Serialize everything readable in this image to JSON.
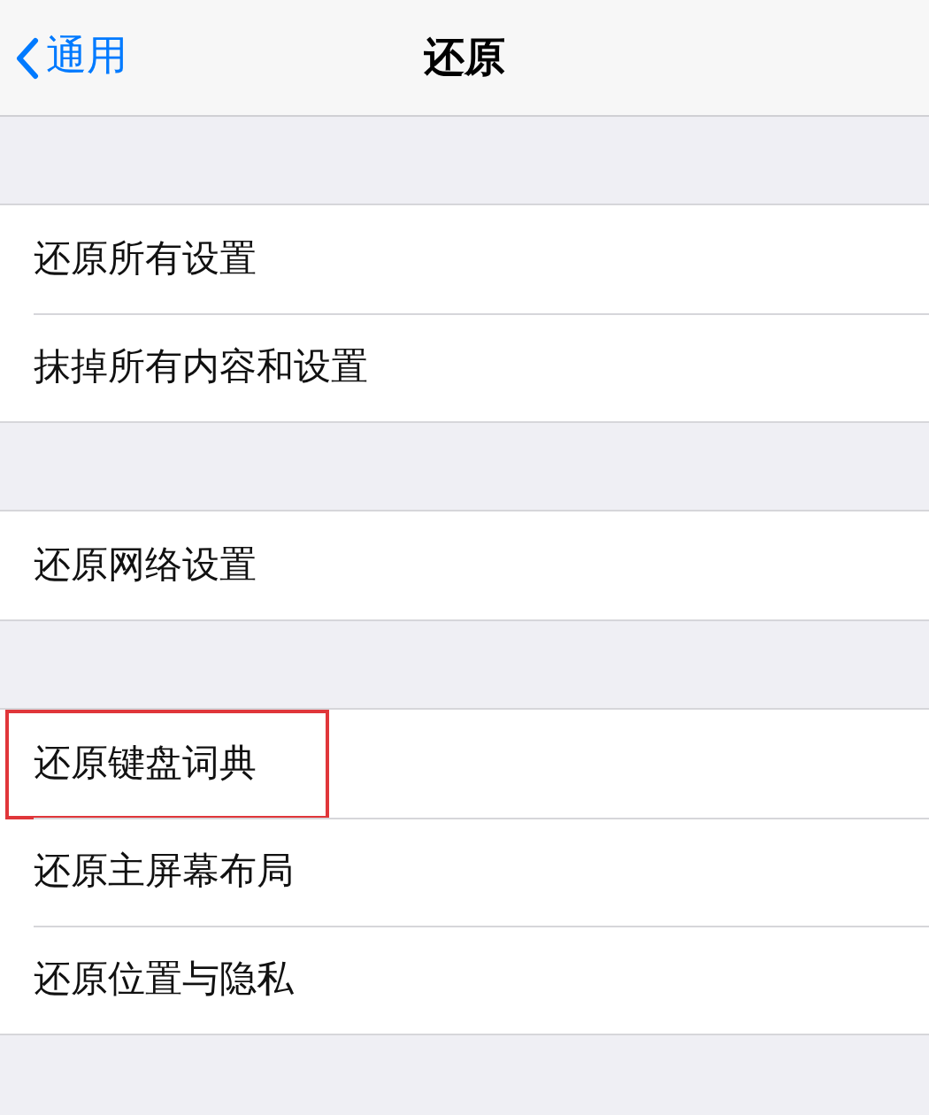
{
  "nav": {
    "back": "通用",
    "title": "还原"
  },
  "groups": [
    {
      "items": [
        {
          "label": "还原所有设置",
          "highlighted": false
        },
        {
          "label": "抹掉所有内容和设置",
          "highlighted": false
        }
      ]
    },
    {
      "items": [
        {
          "label": "还原网络设置",
          "highlighted": false
        }
      ]
    },
    {
      "items": [
        {
          "label": "还原键盘词典",
          "highlighted": true
        },
        {
          "label": "还原主屏幕布局",
          "highlighted": false
        },
        {
          "label": "还原位置与隐私",
          "highlighted": false
        }
      ]
    }
  ]
}
